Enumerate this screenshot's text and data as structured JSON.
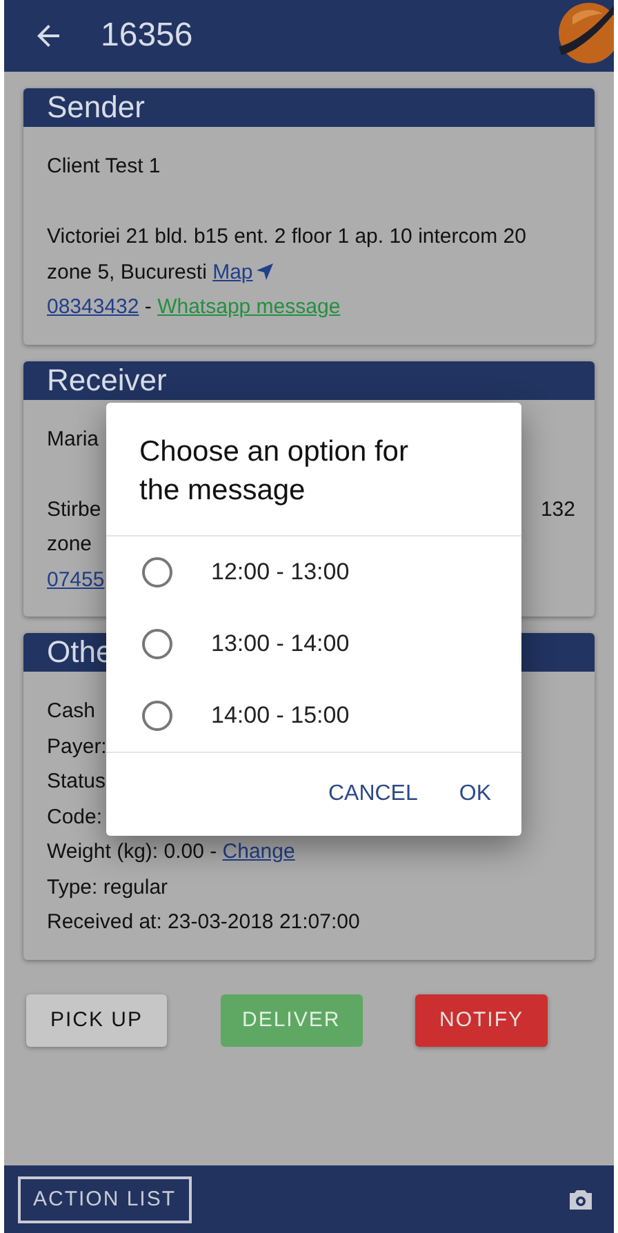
{
  "app_bar": {
    "title": "16356"
  },
  "sections": [
    {
      "title": "Sender",
      "paragraphs": [
        [
          {
            "segments": [
              {
                "kind": "plain",
                "text": "Client Test 1"
              }
            ]
          }
        ],
        [
          {
            "segments": [
              {
                "kind": "plain",
                "text": "Victoriei 21 bld. b15 ent. 2 floor 1 ap. 10 intercom 20 zone 5, Bucuresti "
              },
              {
                "kind": "map",
                "text": "Map"
              }
            ]
          },
          {
            "segments": [
              {
                "kind": "phone",
                "text": "08343432"
              },
              {
                "kind": "plain",
                "text": " - "
              },
              {
                "kind": "whatsapp",
                "text": "Whatsapp message"
              }
            ]
          }
        ]
      ]
    },
    {
      "title": "Receiver",
      "paragraphs": [
        [
          {
            "segments": [
              {
                "kind": "plain",
                "text": "Maria"
              }
            ]
          }
        ],
        [
          {
            "segments": [
              {
                "kind": "plain",
                "text": "Stirbe"
              }
            ],
            "trailing": "132"
          },
          {
            "segments": [
              {
                "kind": "plain",
                "text": "zone"
              }
            ]
          },
          {
            "segments": [
              {
                "kind": "phone",
                "text": "07455"
              }
            ]
          }
        ]
      ]
    },
    {
      "title": "Othe",
      "paragraphs": [
        [
          {
            "segments": [
              {
                "kind": "plain",
                "text": "Cash"
              }
            ]
          },
          {
            "segments": [
              {
                "kind": "plain",
                "text": "Payer:"
              }
            ]
          },
          {
            "segments": [
              {
                "kind": "plain",
                "text": "Status"
              }
            ]
          },
          {
            "segments": [
              {
                "kind": "plain",
                "text": "Code:"
              }
            ]
          },
          {
            "segments": [
              {
                "kind": "plain",
                "text": "Weight (kg): 0.00 - "
              },
              {
                "kind": "phone",
                "text": "Change"
              }
            ]
          },
          {
            "segments": [
              {
                "kind": "plain",
                "text": "Type: regular"
              }
            ]
          },
          {
            "segments": [
              {
                "kind": "plain",
                "text": "Received at: 23-03-2018 21:07:00"
              }
            ]
          }
        ]
      ]
    }
  ],
  "actions": [
    {
      "label": "PICK UP",
      "kind": "default",
      "disabled": false
    },
    {
      "label": "DELIVER",
      "kind": "success",
      "disabled": true
    },
    {
      "label": "NOTIFY",
      "kind": "danger",
      "disabled": false
    }
  ],
  "bottom_bar": {
    "button": "ACTION LIST"
  },
  "dialog": {
    "title": "Choose an option for the message",
    "options": [
      {
        "label": "12:00 - 13:00",
        "selected": false
      },
      {
        "label": "13:00 - 14:00",
        "selected": false
      },
      {
        "label": "14:00 - 15:00",
        "selected": false
      }
    ],
    "buttons": [
      "CANCEL",
      "OK"
    ]
  }
}
